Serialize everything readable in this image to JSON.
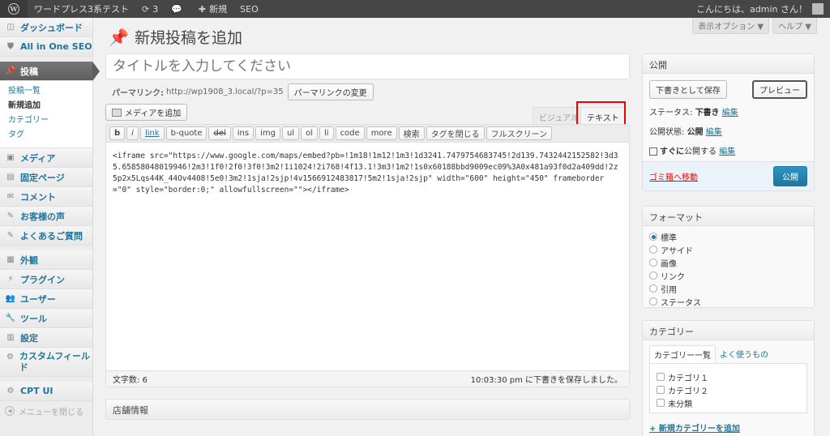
{
  "adminbar": {
    "site_name": "ワードプレス3系テスト",
    "updates_count": "3",
    "new_label": "新規",
    "seo_label": "SEO",
    "greeting": "こんにちは、admin さん！"
  },
  "screen_options": {
    "options_label": "表示オプション ▼",
    "help_label": "ヘルプ ▼"
  },
  "menu": {
    "dashboard": "ダッシュボード",
    "aioseo": "All in One SEO",
    "posts": "投稿",
    "posts_sub": [
      "投稿一覧",
      "新規追加",
      "カテゴリー",
      "タグ"
    ],
    "media": "メディア",
    "pages": "固定ページ",
    "comments": "コメント",
    "voices": "お客様の声",
    "faq": "よくあるご質問",
    "appearance": "外観",
    "plugins": "プラグイン",
    "users": "ユーザー",
    "tools": "ツール",
    "settings": "設定",
    "custom_fields": "カスタムフィールド",
    "cptui": "CPT UI",
    "collapse": "メニューを閉じる"
  },
  "page": {
    "title": "新規投稿を追加",
    "title_placeholder": "タイトルを入力してください",
    "permalink_label": "パーマリンク:",
    "permalink_url": "http://wp1908_3.local/?p=35",
    "permalink_button": "パーマリンクの変更",
    "media_button": "メディアを追加",
    "tab_visual": "ビジュアル",
    "tab_text": "テキスト"
  },
  "quicktags": [
    "b",
    "i",
    "link",
    "b-quote",
    "del",
    "ins",
    "img",
    "ul",
    "ol",
    "li",
    "code",
    "more",
    "検索",
    "タグを閉じる",
    "フルスクリーン"
  ],
  "editor": {
    "content": "<iframe src=\"https://www.google.com/maps/embed?pb=!1m18!1m12!1m3!1d3241.7479754683745!2d139.7432442152582!3d35.65858048019946!2m3!1f0!2f0!3f0!3m2!1i1024!2i768!4f13.1!3m3!1m2!1s0x60188bbd9009ec09%3A0x481a93f0d2a409dd!2z5p2x5Lqs44K_44Ov4408!5e0!3m2!1sja!2sjp!4v1566912483817!5m2!1sja!2sjp\" width=\"600\" height=\"450\" frameborder=\"0\" style=\"border:0;\" allowfullscreen=\"\"></iframe>",
    "word_count": "文字数: 6",
    "autosave": "10:03:30 pm に下書きを保存しました。"
  },
  "store_box": {
    "title": "店舗情報"
  },
  "publish": {
    "title": "公開",
    "save_draft": "下書きとして保存",
    "preview": "プレビュー",
    "status_label": "ステータス:",
    "status_value": "下書き",
    "visibility_label": "公開状態:",
    "visibility_value": "公開",
    "schedule_label": "すぐに",
    "schedule_suffix": "公開する",
    "edit": "編集",
    "trash": "ゴミ箱へ移動",
    "publish_button": "公開"
  },
  "format": {
    "title": "フォーマット",
    "options": [
      "標準",
      "アサイド",
      "画像",
      "リンク",
      "引用",
      "ステータス"
    ],
    "selected": 0
  },
  "category": {
    "title": "カテゴリー",
    "tab_all": "カテゴリー一覧",
    "tab_popular": "よく使うもの",
    "items": [
      "カテゴリ１",
      "カテゴリ２",
      "未分類"
    ],
    "add_new": "+ 新規カテゴリーを追加"
  },
  "colors": {
    "accent": "#21759b",
    "highlight": "#ee0000",
    "adminbar": "#464646"
  }
}
